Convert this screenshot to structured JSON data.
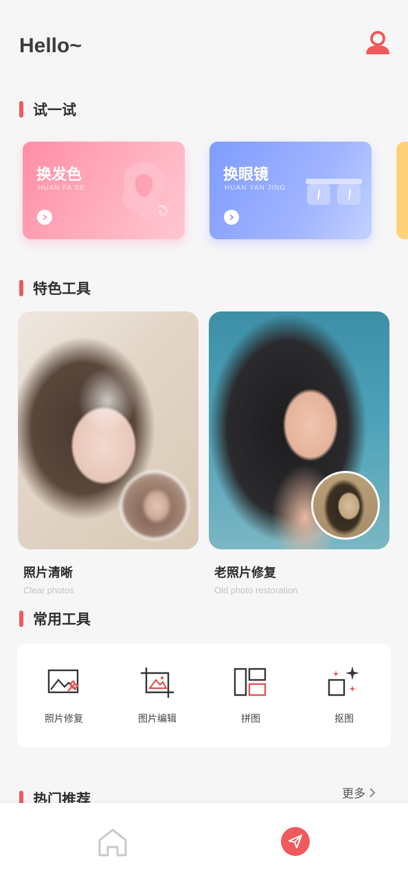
{
  "header": {
    "greeting": "Hello~",
    "profile_icon": "user-icon"
  },
  "sections": {
    "try": "试一试",
    "featured": "特色工具",
    "common": "常用工具",
    "hot": "热门推荐"
  },
  "try_cards": [
    {
      "title": "换发色",
      "subtitle": "HUAN FA SE",
      "icon": "hair-icon"
    },
    {
      "title": "换眼镜",
      "subtitle": "HUAN YAN JING",
      "icon": "glasses-icon"
    }
  ],
  "features": [
    {
      "name": "照片清晰",
      "en": "Clear photos"
    },
    {
      "name": "老照片修复",
      "en": "Old photo restoration"
    }
  ],
  "tools": [
    {
      "label": "照片修复",
      "icon": "photo-repair-icon"
    },
    {
      "label": "图片编辑",
      "icon": "crop-edit-icon"
    },
    {
      "label": "拼图",
      "icon": "collage-icon"
    },
    {
      "label": "抠图",
      "icon": "cutout-sparkle-icon"
    }
  ],
  "more_label": "更多",
  "nav": {
    "home_icon": "home-icon",
    "send_icon": "send-icon"
  },
  "colors": {
    "accent": "#f05a5a",
    "hair_card": "#ff8ea6",
    "glasses_card": "#7f9cff",
    "peek_card": "#ffd27a"
  }
}
